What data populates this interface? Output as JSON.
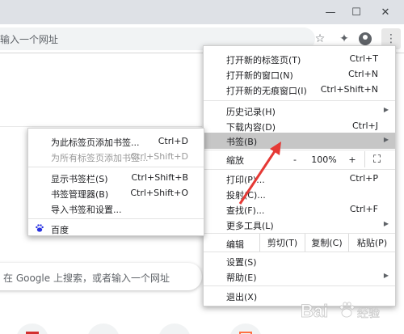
{
  "window": {
    "minimize_icon": "minimize-icon",
    "maximize_icon": "maximize-icon",
    "close_icon": "close-icon",
    "minimize_glyph": "—",
    "maximize_glyph": "☐",
    "close_glyph": "✕"
  },
  "toolbar": {
    "omnibox_text": "输入一个网址",
    "star_glyph": "☆",
    "extension_glyph": "✦",
    "menu_glyph": "⋮"
  },
  "page": {
    "search_placeholder": "在 Google 上搜索，或者输入一个网址"
  },
  "main_menu": {
    "new_tab": {
      "label": "打开新的标签页(T)",
      "shortcut": "Ctrl+T"
    },
    "new_window": {
      "label": "打开新的窗口(N)",
      "shortcut": "Ctrl+N"
    },
    "incognito": {
      "label": "打开新的无痕窗口(I)",
      "shortcut": "Ctrl+Shift+N"
    },
    "history": {
      "label": "历史记录(H)",
      "arrow": "▶"
    },
    "downloads": {
      "label": "下载内容(D)",
      "shortcut": "Ctrl+J"
    },
    "bookmarks": {
      "label": "书签(B)",
      "arrow": "▶"
    },
    "zoom": {
      "label": "缩放",
      "minus": "-",
      "value": "100%",
      "plus": "+",
      "fullscreen": "⛶"
    },
    "print": {
      "label": "打印(P)...",
      "shortcut": "Ctrl+P"
    },
    "cast": {
      "label": "投射(C)..."
    },
    "find": {
      "label": "查找(F)...",
      "shortcut": "Ctrl+F"
    },
    "more_tools": {
      "label": "更多工具(L)",
      "arrow": "▶"
    },
    "edit": {
      "label": "编辑",
      "cut": "剪切(T)",
      "copy": "复制(C)",
      "paste": "粘贴(P)"
    },
    "settings": {
      "label": "设置(S)"
    },
    "help": {
      "label": "帮助(E)",
      "arrow": "▶"
    },
    "exit": {
      "label": "退出(X)"
    }
  },
  "bookmarks_menu": {
    "add_this": {
      "label": "为此标签页添加书签...",
      "shortcut": "Ctrl+D"
    },
    "add_all": {
      "label": "为所有标签页添加书签...",
      "shortcut": "Ctrl+Shift+D"
    },
    "show_bar": {
      "label": "显示书签栏(S)",
      "shortcut": "Ctrl+Shift+B"
    },
    "manager": {
      "label": "书签管理器(B)",
      "shortcut": "Ctrl+Shift+O"
    },
    "import": {
      "label": "导入书签和设置..."
    },
    "baidu": {
      "label": "百度"
    }
  },
  "colors": {
    "highlight": "#c6c6c6",
    "arrow": "#e53935",
    "google_blue": "#4285f4"
  }
}
